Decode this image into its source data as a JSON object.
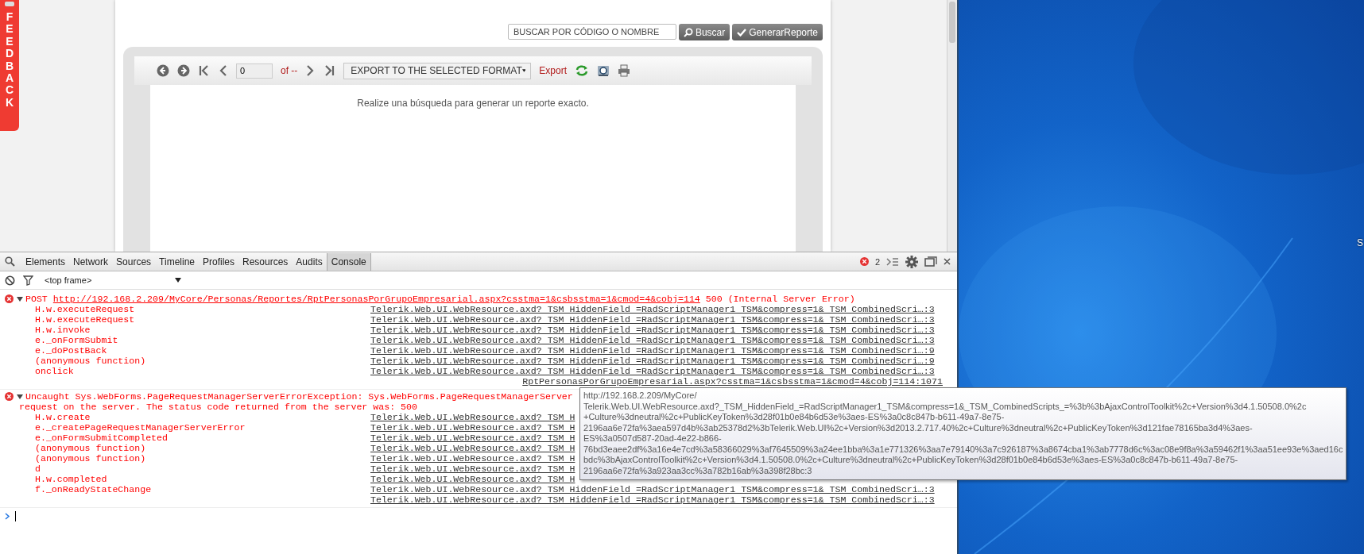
{
  "page": {
    "feedback_tab": "FEEDBACK",
    "search": {
      "placeholder": "BUSCAR POR CÓDIGO O NOMBRE"
    },
    "buttons": [
      {
        "label": "Buscar"
      },
      {
        "label": "GenerarReporte"
      }
    ],
    "report_viewer": {
      "page_number": "0",
      "page_count": "of --",
      "export_format": "EXPORT TO THE SELECTED FORMAT",
      "export_link": "Export",
      "message": "Realize una búsqueda para generar un reporte exacto."
    }
  },
  "devtools": {
    "tabs": [
      {
        "label": "Elements",
        "selected": false
      },
      {
        "label": "Network",
        "selected": false
      },
      {
        "label": "Sources",
        "selected": false
      },
      {
        "label": "Timeline",
        "selected": false
      },
      {
        "label": "Profiles",
        "selected": false
      },
      {
        "label": "Resources",
        "selected": false
      },
      {
        "label": "Audits",
        "selected": false
      },
      {
        "label": "Console",
        "selected": true
      }
    ],
    "error_count": "2",
    "frame_selector": "<top frame>",
    "messages": [
      {
        "kind": "network",
        "expanded": true,
        "method": "POST",
        "url": "http://192.168.2.209/MyCore/Personas/Reportes/RptPersonasPorGrupoEmpresarial.aspx?csstma=1&csbsstma=1&cmod=4&cobj=114",
        "status": "500 (Internal Server Error)",
        "frames": [
          {
            "function": "H.w.executeRequest",
            "source": "Telerik.Web.UI.WebResource.axd? TSM HiddenField =RadScriptManager1 TSM&compress=1& TSM CombinedScri…:3"
          },
          {
            "function": "H.w.executeRequest",
            "source": "Telerik.Web.UI.WebResource.axd? TSM HiddenField =RadScriptManager1 TSM&compress=1& TSM CombinedScri…:3"
          },
          {
            "function": "H.w.invoke",
            "source": "Telerik.Web.UI.WebResource.axd? TSM HiddenField =RadScriptManager1 TSM&compress=1& TSM CombinedScri…:3"
          },
          {
            "function": "e._onFormSubmit",
            "source": "Telerik.Web.UI.WebResource.axd? TSM HiddenField =RadScriptManager1 TSM&compress=1& TSM CombinedScri…:3"
          },
          {
            "function": "e._doPostBack",
            "source": "Telerik.Web.UI.WebResource.axd? TSM HiddenField =RadScriptManager1 TSM&compress=1& TSM CombinedScri…:9"
          },
          {
            "function": "(anonymous function)",
            "source": "Telerik.Web.UI.WebResource.axd? TSM HiddenField =RadScriptManager1 TSM&compress=1& TSM CombinedScri…:9"
          },
          {
            "function": "onclick",
            "source": "Telerik.Web.UI.WebResource.axd? TSM HiddenField =RadScriptManager1 TSM&compress=1& TSM CombinedScri…:3"
          }
        ],
        "source": "RptPersonasPorGrupoEmpresarial.aspx?csstma=1&csbsstma=1&cmod=4&cobj=114:1071"
      },
      {
        "kind": "exception",
        "expanded": true,
        "lines": [
          "Uncaught Sys.WebForms.PageRequestManagerServerErrorException: Sys.WebForms.PageRequestManagerServer",
          "request on the server. The status code returned from the server was: 500"
        ],
        "frames": [
          {
            "function": "H.w.create",
            "source": "Telerik.Web.UI.WebResource.axd? TSM H"
          },
          {
            "function": "e._createPageRequestManagerServerError",
            "source": "Telerik.Web.UI.WebResource.axd? TSM H"
          },
          {
            "function": "e._onFormSubmitCompleted",
            "source": "Telerik.Web.UI.WebResource.axd? TSM H"
          },
          {
            "function": "(anonymous function)",
            "source": "Telerik.Web.UI.WebResource.axd? TSM H"
          },
          {
            "function": "(anonymous function)",
            "source": "Telerik.Web.UI.WebResource.axd? TSM H"
          },
          {
            "function": "d",
            "source": "Telerik.Web.UI.WebResource.axd? TSM H"
          },
          {
            "function": "H.w.completed",
            "source": "Telerik.Web.UI.WebResource.axd? TSM H"
          },
          {
            "function": "f._onReadyStateChange",
            "source": "Telerik.Web.UI.WebResource.axd? TSM HiddenField =RadScriptManager1 TSM&compress=1& TSM CombinedScri…:3"
          },
          {
            "source": "Telerik.Web.UI.WebResource.axd? TSM HiddenField =RadScriptManager1 TSM&compress=1& TSM CombinedScri…:3"
          }
        ]
      }
    ]
  },
  "tooltip": {
    "lines": [
      "http://192.168.2.209/MyCore/",
      "Telerik.Web.UI.WebResource.axd?_TSM_HiddenField_=RadScriptManager1_TSM&compress=1&_TSM_CombinedScripts_=%3b%3bAjaxControlToolkit%2c+Version%3d4.1.50508.0%2c",
      "+Culture%3dneutral%2c+PublicKeyToken%3d28f01b0e84b6d53e%3aes-ES%3a0c8c847b-b611-49a7-8e75-",
      "2196aa6e72fa%3aea597d4b%3ab25378d2%3bTelerik.Web.UI%2c+Version%3d2013.2.717.40%2c+Culture%3dneutral%2c+PublicKeyToken%3d121fae78165ba3d4%3aes-",
      "ES%3a0507d587-20ad-4e22-b866-",
      "76bd3eaee2df%3a16e4e7cd%3a58366029%3af7645509%3a24ee1bba%3a1e771326%3aa7e79140%3a7c926187%3a8674cba1%3ab7778d6c%3ac08e9f8a%3a59462f1%3aa51ee93e%3aed16c",
      "bdc%3bAjaxControlToolkit%2c+Version%3d4.1.50508.0%2c+Culture%3dneutral%2c+PublicKeyToken%3d28f01b0e84b6d53e%3aes-ES%3a0c8c847b-b611-49a7-8e75-",
      "2196aa6e72fa%3a923aa3cc%3a782b16ab%3a398f28bc:3"
    ]
  },
  "desktop": {
    "icon_label": "S"
  }
}
